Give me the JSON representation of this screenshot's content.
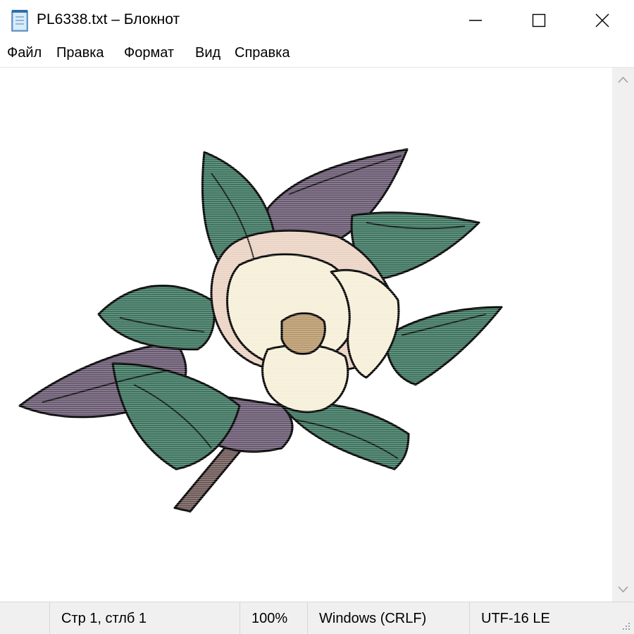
{
  "window": {
    "title": "PL6338.txt – Блокнот",
    "app_icon": "notepad-icon",
    "controls": {
      "minimize_icon": "minimize-icon",
      "maximize_icon": "maximize-icon",
      "close_icon": "close-icon"
    }
  },
  "menu": {
    "items": [
      {
        "label": "Файл"
      },
      {
        "label": "Правка"
      },
      {
        "label": "Формат"
      },
      {
        "label": "Вид"
      },
      {
        "label": "Справка"
      }
    ]
  },
  "editor": {
    "content_image": "magnolia-flower-ascii-art"
  },
  "scrollbar": {
    "up_icon": "chevron-up-icon",
    "down_icon": "chevron-down-icon"
  },
  "status": {
    "position": "Стр 1, стлб 1",
    "zoom": "100%",
    "line_ending": "Windows (CRLF)",
    "encoding": "UTF-16 LE"
  },
  "colors": {
    "leaf_green": "#3e7560",
    "leaf_purple": "#6a5a72",
    "petal_cream": "#f5efd8",
    "petal_peach": "#ead3c3",
    "stem_brown": "#6e5a58",
    "outline": "#000000"
  }
}
